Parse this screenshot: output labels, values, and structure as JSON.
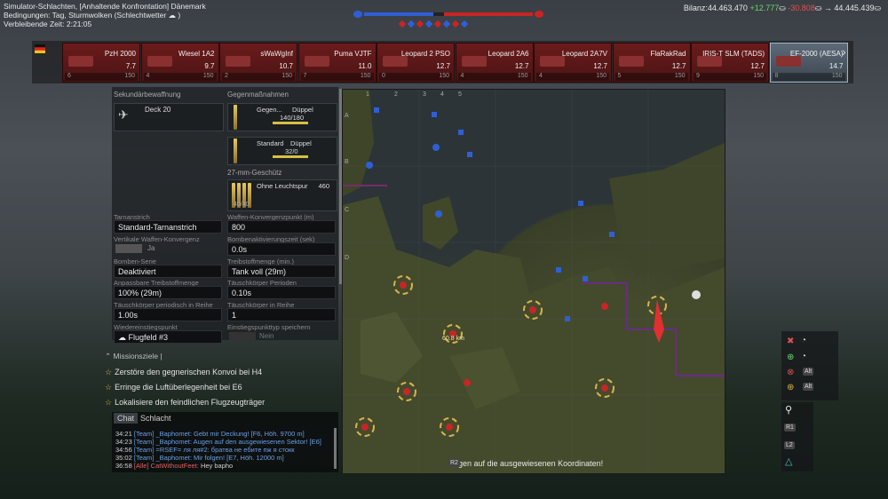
{
  "header": {
    "mode": "Simulator-Schlachten, [Anhaltende Konfrontation] Dänemark",
    "conditions": "Bedingungen: Tag, Sturmwolken  (Schlechtwetter",
    "conditions_end": ")",
    "time_left": "Verbleibende Zeit: 2:21:05"
  },
  "balance": {
    "label": "Bilanz:",
    "value": "44.463.470",
    "plus": "+12.777",
    "minus": "-30.808",
    "total": "44.445.439"
  },
  "colors": {
    "blue_team": "#2f5fd6",
    "red_team": "#c82525",
    "slot_red": "#6b1b1b",
    "slot_selected": "#5d6a78",
    "accent_gold": "#d9b24a"
  },
  "vehicles": [
    {
      "name": "PzH 2000",
      "br": "7.7",
      "count": "6",
      "extra": "150"
    },
    {
      "name": "Wiesel 1A2",
      "br": "9.7",
      "count": "4",
      "extra": "150"
    },
    {
      "name": "sWaWgInf",
      "br": "10.7",
      "count": "2",
      "extra": "150"
    },
    {
      "name": "Puma VJTF",
      "br": "11.0",
      "count": "7",
      "extra": "150"
    },
    {
      "name": "Leopard 2 PSO",
      "br": "12.7",
      "count": "0",
      "extra": "150"
    },
    {
      "name": "Leopard 2A6",
      "br": "12.7",
      "count": "4",
      "extra": "150"
    },
    {
      "name": "Leopard 2A7V",
      "br": "12.7",
      "count": "4",
      "extra": "150"
    },
    {
      "name": "FlaRakRad",
      "br": "12.7",
      "count": "5",
      "extra": "150"
    },
    {
      "name": "IRIS-T SLM (TADS)",
      "br": "12.7",
      "count": "9",
      "extra": "150"
    },
    {
      "name": "EF-2000 (AESA)",
      "br": "14.7",
      "count": "8",
      "extra": "150"
    }
  ],
  "loadout": {
    "secondary_header": "Sekundärbewaffnung",
    "secondary_item": "Deck 20",
    "counter_header": "Gegenmaßnahmen",
    "cm1_top": "Gegen...",
    "cm1_type": "Düppel",
    "cm1_count": "140/180",
    "cm2_top": "Standard",
    "cm2_type": "Düppel",
    "cm2_count": "32/0",
    "gun_header": "27-mm-Geschütz",
    "gun_belt": "Ohne Leuchtspur",
    "gun_count": "460",
    "gun_sub": "40/40"
  },
  "settings": {
    "camo_label": "Tarnanstrich",
    "camo_value": "Standard-Tarnanstrich",
    "conv_label": "Waffen-Konvergenzpunkt (m)",
    "conv_value": "800",
    "vconv_label": "Vertikale Waffen-Konvergenz",
    "vconv_value": "Ja",
    "bomb_time_label": "Bombenaktivierungszeit (sek)",
    "bomb_time_value": "0.0s",
    "bomb_series_label": "Bomben-Serie",
    "bomb_series_value": "Deaktiviert",
    "fuel_label": "Treibstoffmenge (min.)",
    "fuel_value": "Tank voll (29m)",
    "adj_fuel_label": "Anpassbare Treibstoffmenge",
    "adj_fuel_value": "100% (29m)",
    "decoy_period_label": "Täuschkörper Perioden",
    "decoy_period_value": "0.10s",
    "decoy_series_label": "Täuschkörper periodisch in Reihe",
    "decoy_series_value": "1.00s",
    "decoy_row_label": "Täuschkörper in Reihe",
    "decoy_row_value": "1",
    "respawn_label": "Wiedereinstiegspunkt",
    "respawn_value": "Flugfeld #3",
    "save_label": "Einstiegspunkttyp speichern",
    "save_value": "Nein"
  },
  "missions": {
    "header": "Missionsziele",
    "items": [
      "Zerstöre den gegnerischen Konvoi bei  H4",
      "Erringe die Luftüberlegenheit bei  E6",
      "Lokalisiere den feindlichen Flugzeugträger"
    ]
  },
  "chat": {
    "tab_chat": "Chat",
    "tab_battle": "Schlacht",
    "lines": [
      {
        "time": "34:21",
        "tag": "[Team]",
        "name": "_Baphomet:",
        "msg": "Gebt mir Deckung! [F6, Höh. 9700 m]"
      },
      {
        "time": "34:23",
        "tag": "[Team]",
        "name": "_Baphomet:",
        "msg": "Augen auf den ausgewiesenen Sektor! [E6]"
      },
      {
        "time": "34:56",
        "tag": "[Team]",
        "name": "=RSEF=",
        "msg": "ля ля#2: братва не ебите пж я стокк"
      },
      {
        "time": "35:02",
        "tag": "[Team]",
        "name": "_Baphomet:",
        "msg": "Mir folgen! [E7, Höh. 12000 m]"
      },
      {
        "time": "36:58",
        "tag": "[Alle]",
        "name": "CatWithoutFeet:",
        "msg": "Hey bapho"
      }
    ]
  },
  "map": {
    "grid_cols": [
      "1",
      "2",
      "3",
      "4",
      "5"
    ],
    "grid_rows": [
      "A",
      "B",
      "C",
      "D"
    ],
    "distance_marker": "60.8 km",
    "hint_key": "R2",
    "hint": "Augen auf die ausgewiesenen Koordinaten!"
  },
  "controls": {
    "alt1": "Alt",
    "alt2": "Alt",
    "r1": "R1",
    "l2": "L2"
  }
}
